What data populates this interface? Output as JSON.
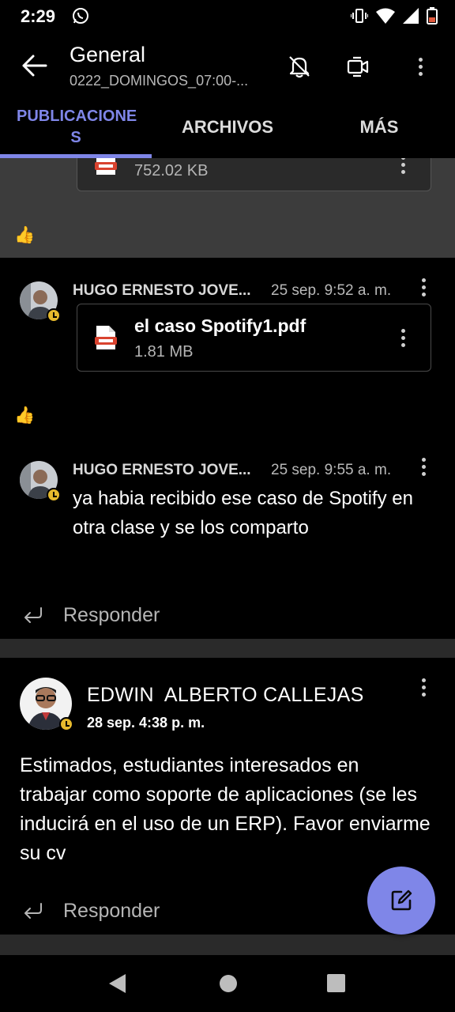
{
  "status_bar": {
    "time": "2:29"
  },
  "app_bar": {
    "title": "General",
    "subtitle": "0222_DOMINGOS_07:00-..."
  },
  "tabs": [
    {
      "label": "PUBLICACIONE S"
    },
    {
      "label": "ARCHIVOS"
    },
    {
      "label": "MÁS"
    }
  ],
  "feed": {
    "top_file": {
      "size": "752.02 KB"
    },
    "top_reaction": "👍",
    "post1": {
      "author": "HUGO ERNESTO JOVE...",
      "time": "25 sep. 9:52 a. m.",
      "file_name": "el caso Spotify1.pdf",
      "file_size": "1.81 MB",
      "reaction": "👍"
    },
    "post2": {
      "author": "HUGO ERNESTO JOVE...",
      "time": "25 sep. 9:55 a. m.",
      "text": "ya habia recibido ese caso de Spotify en otra clase y se los comparto"
    },
    "reply_label": "Responder",
    "post3": {
      "author": "EDWIN  ALBERTO CALLEJAS",
      "time": "28 sep. 4:38 p. m.",
      "text": "Estimados, estudiantes interesados en trabajar como soporte de aplicaciones (se les inducirá en el uso de un ERP). Favor enviarme su cv"
    }
  },
  "colors": {
    "accent": "#7f86e8",
    "presence": "#e6b92d"
  }
}
